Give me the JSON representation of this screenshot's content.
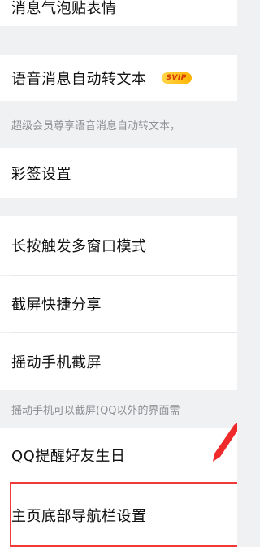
{
  "settings": {
    "bubble_sticker": "消息气泡贴表情",
    "voice_to_text": "语音消息自动转文本",
    "voice_badge": "SVIP",
    "voice_note": "超级会员尊享语音消息自动转文本，",
    "colorful_sign": "彩签设置",
    "long_press_multiwindow": "长按触发多窗口模式",
    "screenshot_share": "截屏快捷分享",
    "shake_screenshot": "摇动手机截屏",
    "shake_note": "摇动手机可以截屏(QQ以外的界面需",
    "birthday_reminder": "QQ提醒好友生日",
    "bottom_nav_settings": "主页底部导航栏设置"
  },
  "colors": {
    "highlight": "#f03a3a",
    "badge": "#ffc21a"
  },
  "icons": {
    "annotation_arrow": "red-arrow-icon"
  }
}
